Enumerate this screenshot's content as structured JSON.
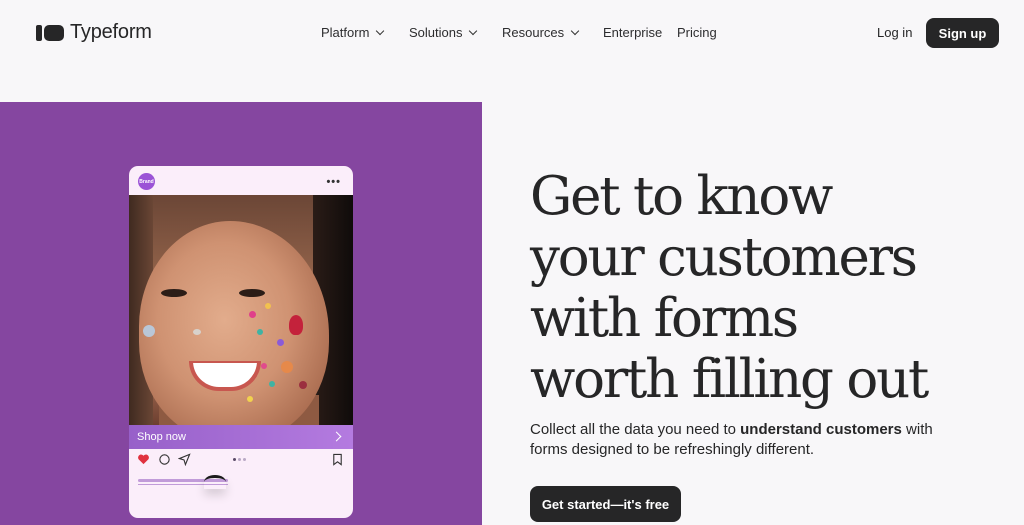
{
  "brand": {
    "name": "Typeform"
  },
  "nav": {
    "items": [
      {
        "label": "Platform",
        "dropdown": true
      },
      {
        "label": "Solutions",
        "dropdown": true
      },
      {
        "label": "Resources",
        "dropdown": true
      },
      {
        "label": "Enterprise",
        "dropdown": false
      },
      {
        "label": "Pricing",
        "dropdown": false
      }
    ],
    "login_label": "Log in",
    "signup_label": "Sign up"
  },
  "hero": {
    "headline_lines": [
      "Get to know",
      "your customers",
      "with forms",
      "worth filling out"
    ],
    "subtitle_pre": "Collect all the data you need to ",
    "subtitle_bold": "understand customers",
    "subtitle_post": " with forms designed to be refreshingly different.",
    "cta_label": "Get started—it's free",
    "panel_color": "#8546a0"
  },
  "phone_mock": {
    "brand_avatar_text": "Brand",
    "shop_label": "Shop now",
    "icons": [
      "heart-icon",
      "comment-icon",
      "send-icon",
      "bookmark-icon",
      "more-icon"
    ]
  },
  "colors": {
    "accent_dark": "#262627",
    "background": "#f8f7f9",
    "shop_bar": "#9f67d3"
  }
}
